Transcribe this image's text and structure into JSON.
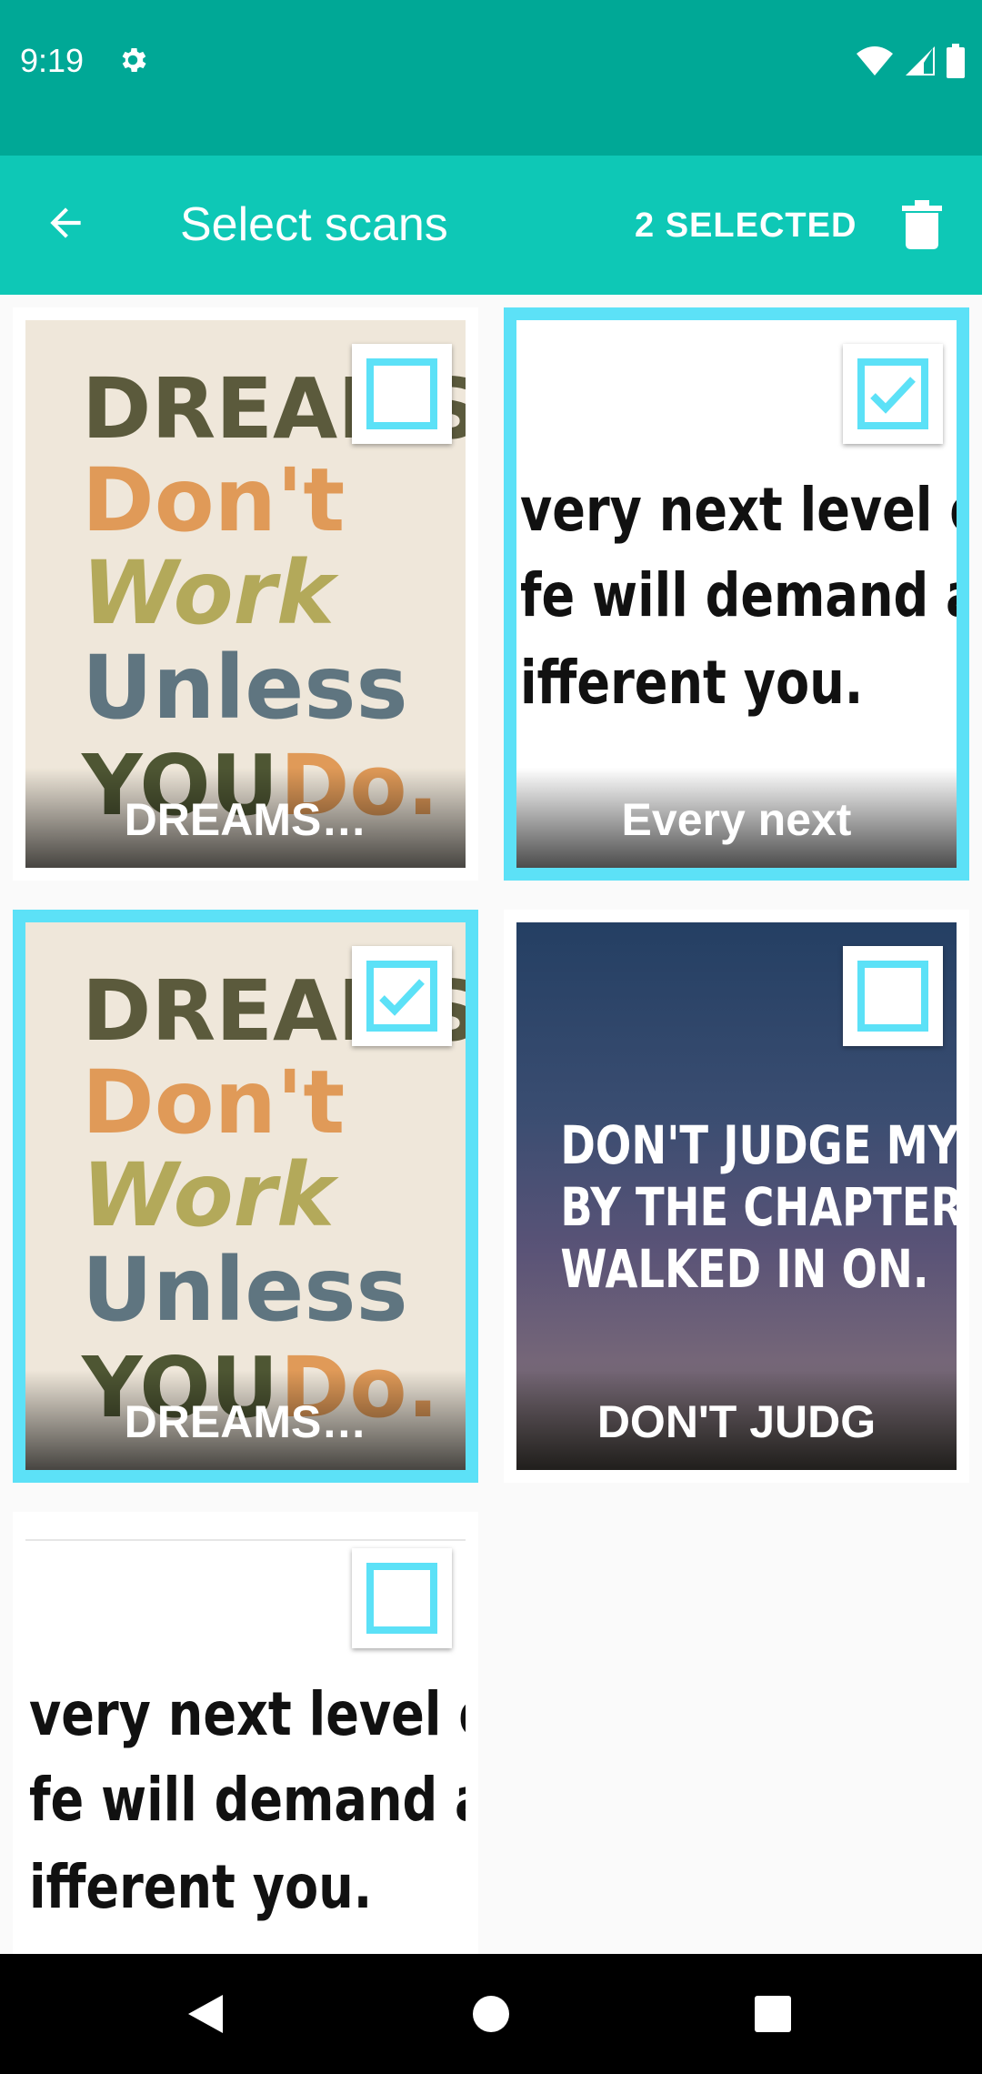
{
  "status_bar": {
    "time": "9:19"
  },
  "app_bar": {
    "title": "Select scans",
    "selected_label": "2 SELECTED"
  },
  "scans": [
    {
      "caption": "DREAMS…",
      "selected": false
    },
    {
      "caption": "Every next",
      "selected": true
    },
    {
      "caption": "DREAMS…",
      "selected": true
    },
    {
      "caption": "DON'T JUDG",
      "selected": false
    },
    {
      "caption": "",
      "selected": false
    }
  ],
  "posters": {
    "dreams": [
      "DREAMS",
      "Don't",
      "Work",
      "Unless",
      "YOU",
      "Do."
    ],
    "level": [
      "very next level of you",
      "fe will demand a",
      "ifferent you."
    ],
    "judge": [
      "DON'T JUDGE MY STORY",
      "BY THE CHAPTER YOU",
      "WALKED IN ON."
    ]
  },
  "colors": {
    "accent": "#5ce1f7",
    "status_bar": "#00a896",
    "app_bar": "#0ec8b6"
  }
}
